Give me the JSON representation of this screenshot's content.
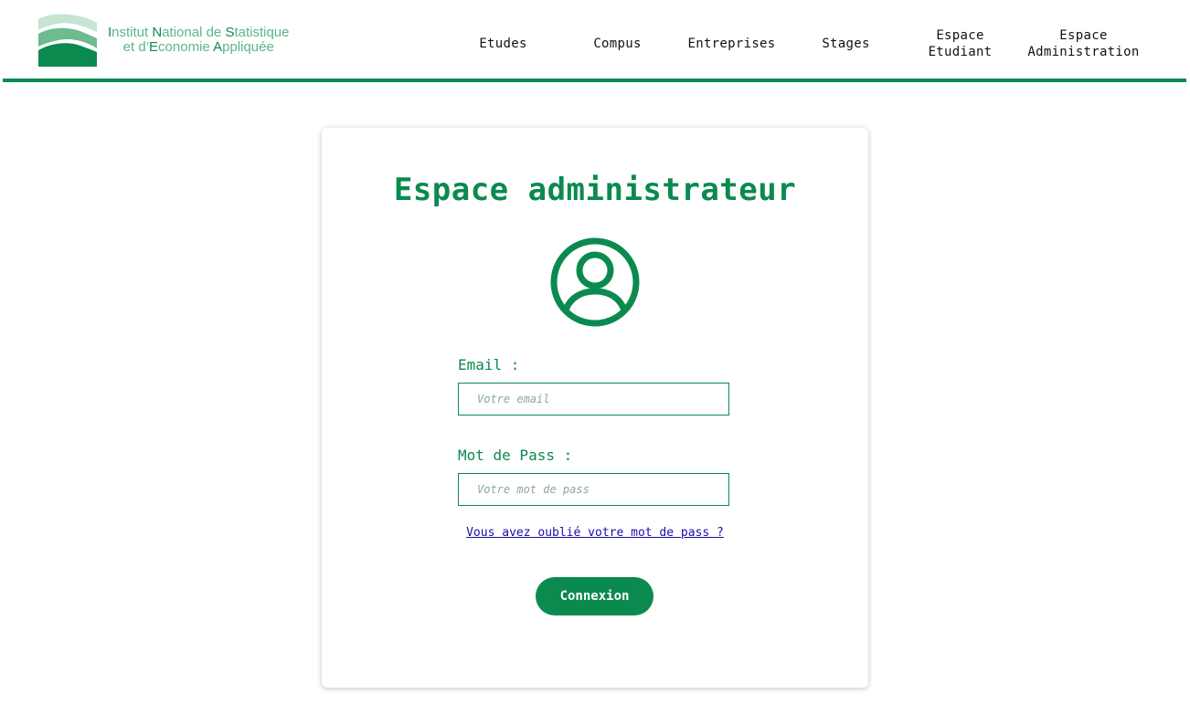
{
  "logo": {
    "line1": [
      {
        "t": "I",
        "cap": true
      },
      {
        "t": "nstitut ",
        "cap": false
      },
      {
        "t": "N",
        "cap": true
      },
      {
        "t": "ational de ",
        "cap": false
      },
      {
        "t": "S",
        "cap": true
      },
      {
        "t": "tatistique",
        "cap": false
      }
    ],
    "line2": [
      {
        "t": "et d’",
        "cap": false
      },
      {
        "t": "E",
        "cap": true
      },
      {
        "t": "conomie ",
        "cap": false
      },
      {
        "t": "A",
        "cap": true
      },
      {
        "t": "ppliquée",
        "cap": false
      }
    ],
    "colors": {
      "light": "#c6e4d3",
      "mid": "#6dbb8f",
      "dark": "#0b8a50"
    }
  },
  "nav": {
    "items": [
      {
        "label": "Etudes"
      },
      {
        "label": "Compus"
      },
      {
        "label": "Entreprises"
      },
      {
        "label": "Stages"
      },
      {
        "label": "Espace\nEtudiant"
      },
      {
        "label": "Espace\nAdministration"
      }
    ]
  },
  "login": {
    "title": "Espace administrateur",
    "avatar_icon": "user-circle-icon",
    "email_label": "Email :",
    "email_placeholder": "Votre email",
    "email_value": "",
    "password_label": "Mot de Pass :",
    "password_placeholder": "Votre mot de pass",
    "password_value": "",
    "forgot_link": "Vous avez oublié votre mot de pass ?",
    "submit_label": "Connexion"
  },
  "colors": {
    "accent": "#0b8a50",
    "link": "#1a0dab"
  }
}
